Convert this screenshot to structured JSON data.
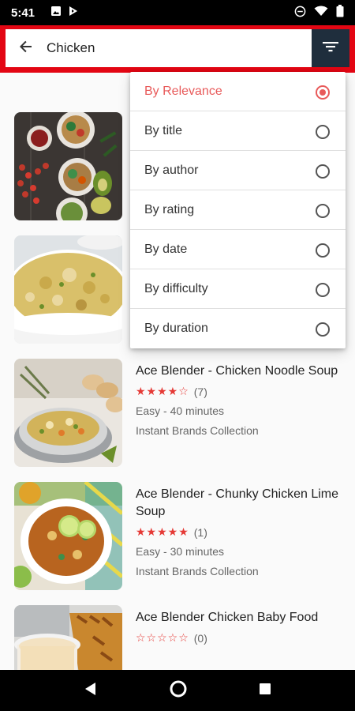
{
  "status_bar": {
    "time": "5:41",
    "icons_left": [
      "image-icon",
      "play-store-icon"
    ],
    "icons_right": [
      "do-not-disturb-icon",
      "wifi-icon",
      "battery-icon"
    ]
  },
  "search": {
    "value": "Chicken",
    "accent_color": "#e30613",
    "filter_button_color": "#1f2e3d"
  },
  "sort_menu": {
    "options": [
      {
        "label": "By Relevance",
        "selected": true
      },
      {
        "label": "By title",
        "selected": false
      },
      {
        "label": "By author",
        "selected": false
      },
      {
        "label": "By rating",
        "selected": false
      },
      {
        "label": "By date",
        "selected": false
      },
      {
        "label": "By difficulty",
        "selected": false
      },
      {
        "label": "By duration",
        "selected": false
      }
    ],
    "selected_color": "#e85a5a"
  },
  "recipes": [
    {
      "title": "",
      "image": "tacos-bowls-photo"
    },
    {
      "title": "",
      "image": "chicken-pasta-photo"
    },
    {
      "title": "Ace Blender - Chicken Noodle Soup",
      "stars": "★★★★☆",
      "rating": 4,
      "count": "(7)",
      "meta": "Easy - 40 minutes",
      "collection": "Instant Brands Collection",
      "image": "noodle-soup-photo"
    },
    {
      "title": "Ace Blender - Chunky Chicken Lime Soup",
      "stars": "★★★★★",
      "rating": 5,
      "count": "(1)",
      "meta": "Easy - 30 minutes",
      "collection": "Instant Brands Collection",
      "image": "lime-soup-photo"
    },
    {
      "title": "Ace Blender Chicken Baby Food",
      "stars": "☆☆☆☆☆",
      "rating": 0,
      "count": "(0)",
      "meta": "",
      "collection": "",
      "image": "baby-food-photo"
    }
  ],
  "nav_bar": {
    "icons": [
      "back-nav-icon",
      "home-nav-icon",
      "recents-nav-icon"
    ]
  }
}
